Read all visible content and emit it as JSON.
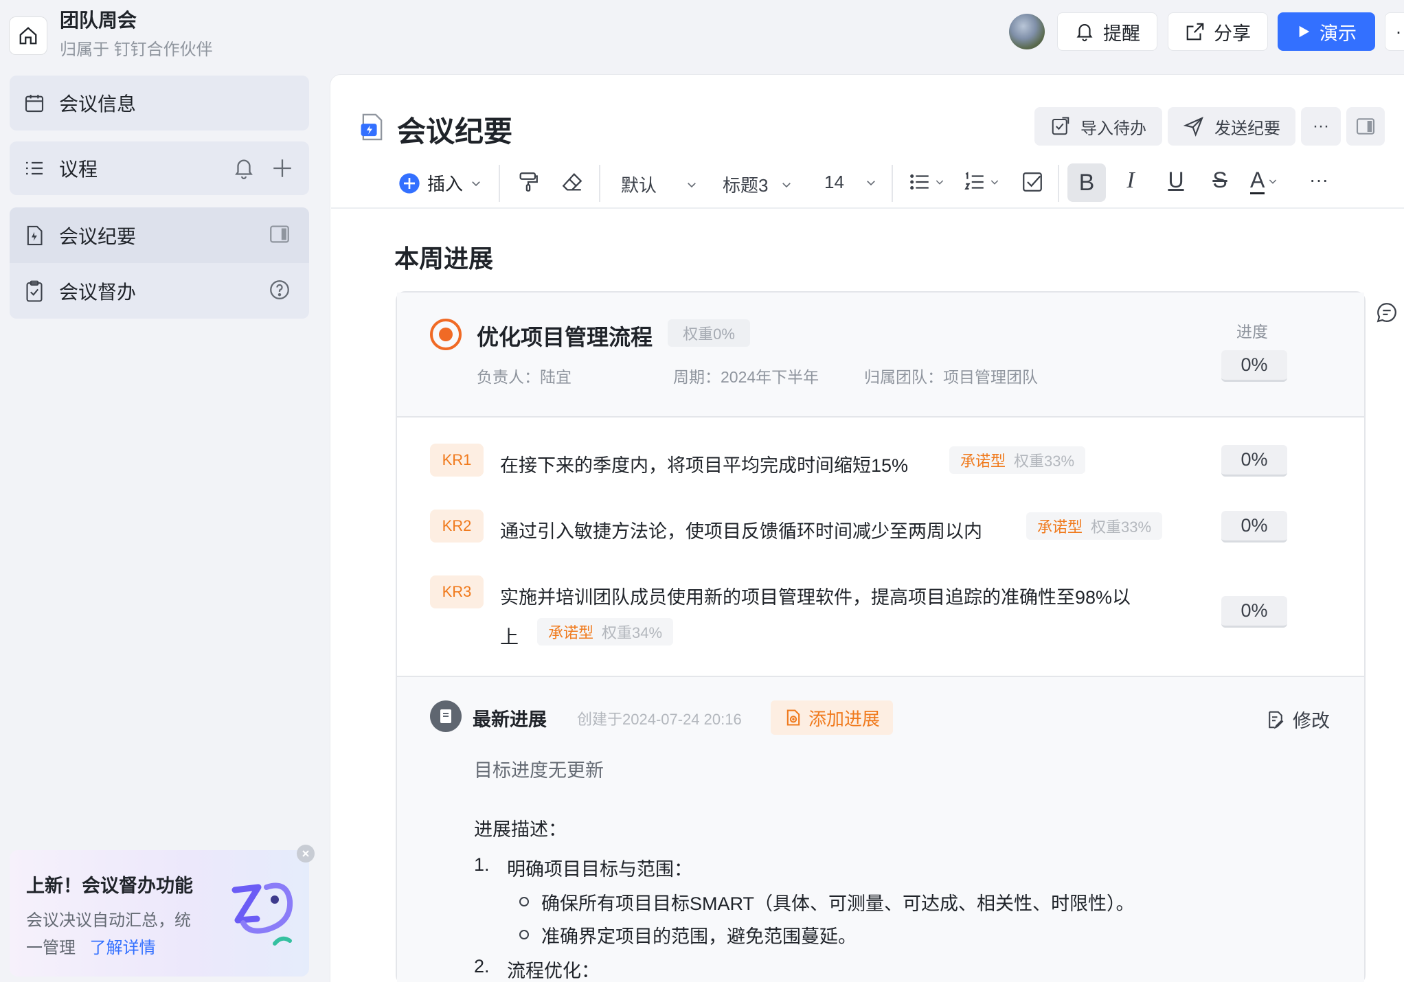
{
  "header": {
    "title": "团队周会",
    "subtitle": "归属于 钉钉合作伙伴",
    "remind_label": "提醒",
    "share_label": "分享",
    "present_label": "演示",
    "more_label": "·"
  },
  "sidebar": {
    "meeting_info": "会议信息",
    "agenda": "议程",
    "minutes": "会议纪要",
    "supervision": "会议督办",
    "promo": {
      "title": "上新！会议督办功能",
      "desc_line1": "会议决议自动汇总，统",
      "desc_line2": "一管理",
      "link": "了解详情"
    }
  },
  "doc": {
    "title": "会议纪要",
    "import_todo": "导入待办",
    "send_minutes": "发送纪要",
    "more": "···"
  },
  "toolbar": {
    "insert": "插入",
    "style": "默认",
    "heading": "标题3",
    "font_size": "14",
    "bold": "B",
    "italic": "I",
    "underline": "U",
    "strike": "S",
    "font_color": "A",
    "more": "···"
  },
  "content": {
    "section_title": "本周进展",
    "objective": {
      "title": "优化项目管理流程",
      "weight": "权重0%",
      "owner": "负责人：陆宜",
      "period": "周期：2024年下半年",
      "team": "归属团队：项目管理团队",
      "progress_label": "进度",
      "progress_value": "0%"
    },
    "key_results": [
      {
        "badge": "KR1",
        "text": "在接下来的季度内，将项目平均完成时间缩短15%",
        "type": "承诺型",
        "weight": "权重33%",
        "progress": "0%"
      },
      {
        "badge": "KR2",
        "text": "通过引入敏捷方法论，使项目反馈循环时间减少至两周以内",
        "type": "承诺型",
        "weight": "权重33%",
        "progress": "0%"
      },
      {
        "badge": "KR3",
        "text_line1": "实施并培训团队成员使用新的项目管理软件，提高项目追踪的准确性至98%以",
        "text_line2": "上",
        "type": "承诺型",
        "weight": "权重34%",
        "progress": "0%"
      }
    ],
    "latest": {
      "title": "最新进展",
      "created": "创建于2024-07-24 20:16",
      "add_label": "添加进展",
      "edit_label": "修改",
      "no_update": "目标进度无更新",
      "desc_label": "进展描述：",
      "items": [
        {
          "num": "1.",
          "title": "明确项目目标与范围：",
          "bullets": [
            "确保所有项目目标SMART（具体、可测量、可达成、相关性、时限性）。",
            "准确界定项目的范围，避免范围蔓延。"
          ]
        },
        {
          "num": "2.",
          "title": "流程优化："
        }
      ]
    }
  }
}
